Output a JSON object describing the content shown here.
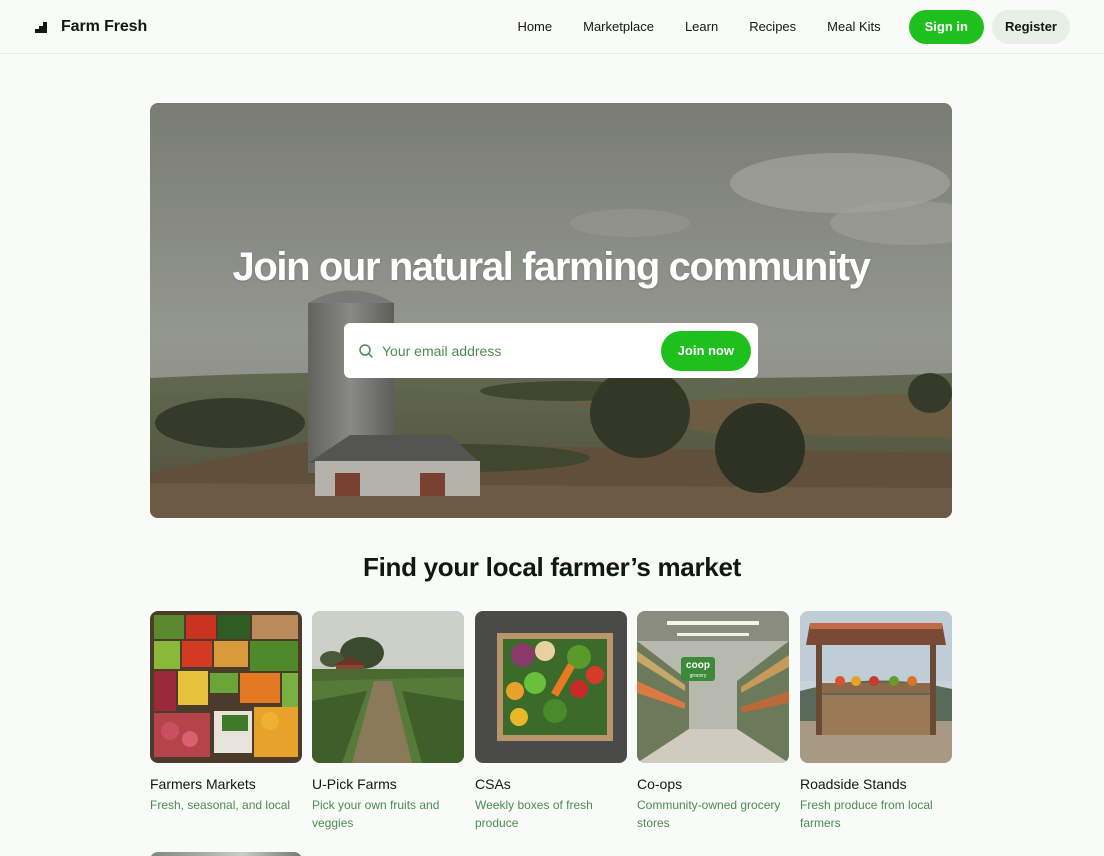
{
  "header": {
    "brand": "Farm Fresh",
    "brand_icon": "farm-logo-icon",
    "nav": [
      "Home",
      "Marketplace",
      "Learn",
      "Recipes",
      "Meal Kits"
    ],
    "signin_label": "Sign in",
    "register_label": "Register"
  },
  "hero": {
    "title": "Join our natural farming community",
    "email_placeholder": "Your email address",
    "join_label": "Join now",
    "search_icon": "search-icon"
  },
  "section": {
    "title": "Find your local farmer’s market"
  },
  "cards": [
    {
      "title": "Farmers Markets",
      "subtitle": "Fresh, seasonal, and local"
    },
    {
      "title": "U-Pick Farms",
      "subtitle": "Pick your own fruits and veggies"
    },
    {
      "title": "CSAs",
      "subtitle": "Weekly boxes of fresh produce"
    },
    {
      "title": "Co-ops",
      "subtitle": "Community-owned grocery stores"
    },
    {
      "title": "Roadside Stands",
      "subtitle": "Fresh produce from local farmers"
    }
  ],
  "coop_sign": {
    "line1": "coop",
    "line2": "grocery"
  },
  "colors": {
    "accent": "#1ec01e",
    "secondary_button": "#e8efe6",
    "subtitle": "#4d8a52",
    "background": "#f8fbf7"
  }
}
